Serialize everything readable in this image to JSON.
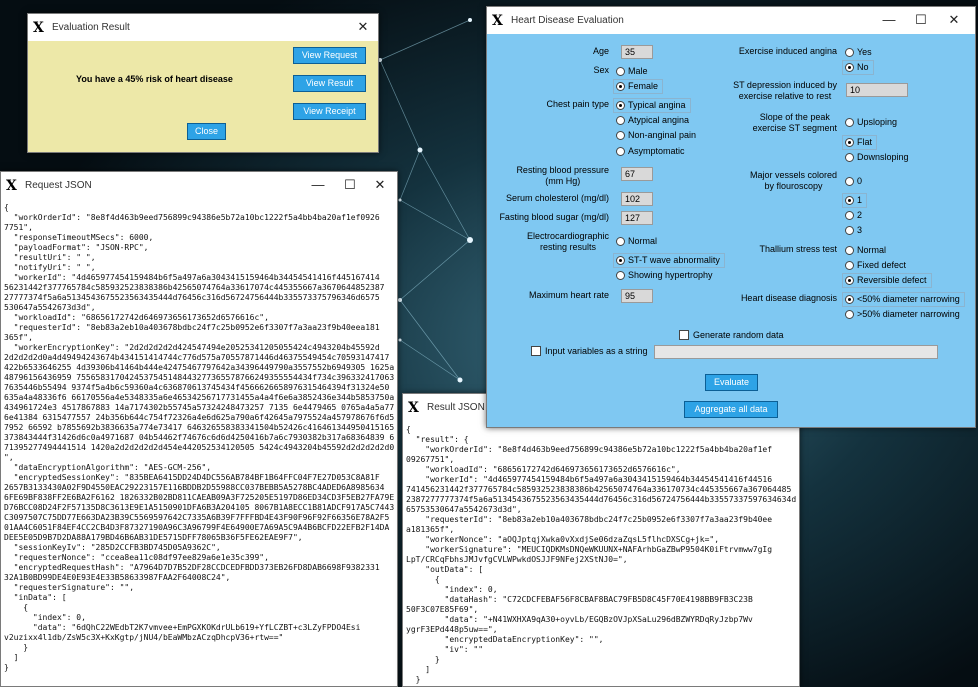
{
  "eval_window": {
    "title": "Evaluation Result",
    "message": "You have a 45% risk of heart disease",
    "buttons": {
      "view_request": "View Request",
      "view_result": "View Result",
      "view_receipt": "View Receipt",
      "close": "Close"
    }
  },
  "request_window": {
    "title": "Request JSON",
    "text": "{\n  \"workOrderId\": \"8e8f4d463b9eed756899c94386e5b72a10bc1222f5a4bb4ba20af1ef0926\n7751\",\n  \"responseTimeoutMSecs\": 6000,\n  \"payloadFormat\": \"JSON-RPC\",\n  \"resultUri\": \" \",\n  \"notifyUri\": \" \",\n  \"workerId\": \"4d465977454159484b6f5a497a6a3043415159464b34454541416f445167414\n56231442f377765784c585932523838386b42565074764a33617074c445355667a3670644852387\n27777374f5a6a5134543675523563435444d76456c316d56724756444b335573375796346d6575\n530647a5542673d3d\",\n  \"workloadId\": \"68656172742d646973656173652d6576616c\",\n  \"requesterId\": \"8eb83a2eb10a403678bdbc24f7c25b0952e6f3307f7a3aa23f9b40eea181\n365f\",\n  \"workerEncryptionKey\": \"2d2d2d2d2d424547494e20525341205055424c4943204b45592d\n2d2d2d2d0a4d49494243674b434151414744c776d575a70557871446d46375549454c70593147417\n422b6533646255 4d39306b41464b444e42475467797642a34396449790a3557552b6949305 1625a\n48796156436959 7556583170424537545148443277365578766249355554434f734c396332417063\n7635446b55494 9374f5a4b6c59360a4c636870613745434f4566626658976315464394f31324e50\n635a4a48336f6 66170556a4e5348335a6e46534256717731455a4a4f6e6a3852436e344b5853750a\n434961724e3 4517867883 14a7174302b55745a57324248473257 7135 6e4479465 0765a4a5a775539\n6e41384 6315477557 24b356b644c754f72326a4e6d625a790a6f42645a7975524a457978676f6d59\n7952 66592 b7855692b3836635a774e73417 646326558383341504b52426c41646134495041516550\n373843444f31426d6c0a4971687 04b54462f74676c6d6d4250416b7a6c7930382b317a68364839 6e\n71395277494441514 1420a2d2d2d2d2d454e442052534120505 5424c4943204b45592d2d2d2d2d0a\n\",\n  \"dataEncryptionAlgorithm\": \"AES-GCM-256\",\n  \"encryptedSessionKey\": \"835BEA6415DD24D4DC556AB784BF1B64FFC04F7E27D053C8A81F\n2657B3133430A02F9D4550EAC29223157E116BDDB2D55988CC037BEBB5A5278BC4ADED6A8985634\n6FE69BF838FF2E6BA2F6162 1826332B02BD811CAEAB09A3F725205E5197D86ED34CD3F5EB27FA79E43\nD76BCC08D24F2F57135D8C3613E9E1A5150901DFA6B3A204105 8067B1A8ECC1B81ADCF917A5C7443\nC3097507C75DD77E663DA23B39C5569597642C7335A6B39F7FFFBD4E43F90F96F92F66356E78A2F5\n01AA4C6051F84EF4CC2CB4D3F87327190A96C3A96799F4E64900E7A69A5C9A4B6BCFD22EFB2F14DA\nDEE5E05D9B7D2DA88A179BD46B6AB31DE5715DFF78065B36F5FE62EAE9F7\",\n  \"sessionKeyIv\": \"285D2CCFB3BD745D05A9362C\",\n  \"requesterNonce\": \"ccea8ea11c08df97ee829a6e1e35c399\",\n  \"encryptedRequestHash\": \"A7964D7D7B52DF28CCDCEDFBDD373EB26FD8DAB6698F9382331\n32A1B0BD99DE4E0E93E4E33B58633987FAA2F64008C24\",\n  \"requesterSignature\": \"\",\n  \"inData\": [\n    {\n      \"index\": 0,\n      \"data\": \"6dQhC22WEdbT2K7vmvee+EmPGXKOKdrULb619+YfLCZBT+c3LZyFPDO4Esi\nv2uzixx4l1db/ZsW5c3X+KxKgtp/jNU4/bEaWMbzACzqDhcpV36+rtw==\"\n    }\n  ]\n}"
  },
  "result_window": {
    "title": "Result JSON",
    "text": "{\n  \"result\": {\n    \"workOrderId\": \"8e8f4d463b9eed756899c94386e5b72a10bc1222f5a4bb4ba20af1ef\n09267751\",\n    \"workloadId\": \"68656172742d646973656173652d6576616c\",\n    \"workerId\": \"4d465977454159484b6f5a497a6a3043415159464b34454541416f44516\n741456231442f377765784c585932523838386b42565074764a336170734c445355667a367064485\n2387277777374f5a6a5134543675523563435444d76456c316d56724756444b33557337597634634d\n65753530647a5542673d3d\",\n    \"requesterId\": \"8eb83a2eb10a403678bdbc24f7c25b0952e6f3307f7a3aa23f9b40ee\na181365f\",\n    \"workerNonce\": \"aOQJptqjXwka0vXxdjSe06dzaZqsL5flhcDXSCg+jk=\",\n    \"workerSignature\": \"MEUCIQDKMsDNQeWKUUNX+NAFArhbGaZBwP9504K0iFtrvmww7gIg\nLpT/CRCqFbhsJMJvfgCVLWPwkdOSJJF9NFej2XStNJ0=\",\n    \"outData\": [\n      {\n        \"index\": 0,\n        \"dataHash\": \"C72CDCFEBAF56F8CBAF8BAC79FB5D8C45F70E4198BB9FB3C23B\n50F3C07E85F69\",\n        \"data\": \"+N41WXHXA9qA30+oyvLb/EGQBzOVJpXSaLu296dBZWYRDqRyJzbp7Wv\nygrF3EPd448p5uw==\",\n        \"encryptedDataEncryptionKey\": \"\",\n        \"iv\": \"\"\n      }\n    ]\n  }"
  },
  "hd_window": {
    "title": "Heart Disease Evaluation",
    "age": {
      "label": "Age",
      "value": "35"
    },
    "sex": {
      "label": "Sex",
      "options": [
        "Male",
        "Female"
      ],
      "selected": 1
    },
    "cp": {
      "label": "Chest pain type",
      "options": [
        "Typical angina",
        "Atypical angina",
        "Non-anginal pain",
        "Asymptomatic"
      ],
      "selected": 0
    },
    "bp": {
      "label": "Resting blood pressure\n(mm Hg)",
      "value": "67"
    },
    "chol": {
      "label": "Serum cholesterol (mg/dl)",
      "value": "102"
    },
    "fbs": {
      "label": "Fasting blood sugar (mg/dl)",
      "value": "127"
    },
    "ecg": {
      "label": "Electrocardiographic\nresting results",
      "options": [
        "Normal",
        "ST-T wave abnormality",
        "Showing hypertrophy"
      ],
      "selected": 1
    },
    "hr": {
      "label": "Maximum heart rate",
      "value": "95"
    },
    "angina": {
      "label": "Exercise induced angina",
      "options": [
        "Yes",
        "No"
      ],
      "selected": 1
    },
    "st": {
      "label": "ST depression induced by\nexercise relative to rest",
      "value": "10"
    },
    "slope": {
      "label": "Slope of the peak\nexercise ST segment",
      "options": [
        "Upsloping",
        "Flat",
        "Downsloping"
      ],
      "selected": 1
    },
    "vessels": {
      "label": "Major vessels colored\nby flouroscopy",
      "options": [
        "0",
        "1",
        "2",
        "3"
      ],
      "selected": 1
    },
    "thal": {
      "label": "Thallium stress test",
      "options": [
        "Normal",
        "Fixed defect",
        "Reversible defect"
      ],
      "selected": 2
    },
    "diag": {
      "label": "Heart disease diagnosis",
      "options": [
        "<50% diameter narrowing",
        ">50% diameter narrowing"
      ],
      "selected": 0
    },
    "random_label": "Generate random data",
    "input_string_label": "Input variables as a string",
    "evaluate_label": "Evaluate",
    "aggregate_label": "Aggregate all data"
  }
}
